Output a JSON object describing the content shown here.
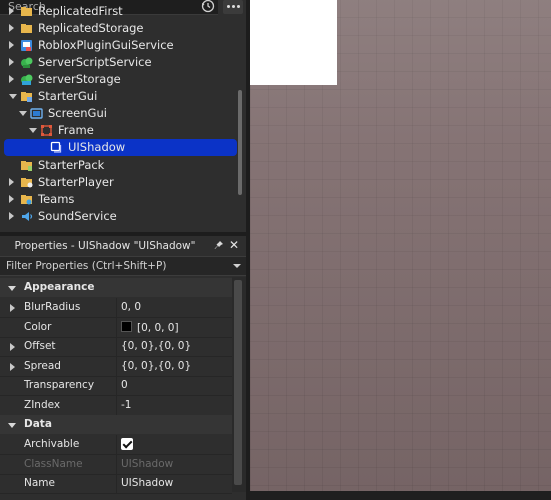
{
  "search": {
    "placeholder": "Search"
  },
  "explorer": {
    "items": [
      {
        "label": "ReplicatedFirst",
        "icon": "replicated-first-icon",
        "indent": 0,
        "arrow": "right"
      },
      {
        "label": "ReplicatedStorage",
        "icon": "folder-icon",
        "indent": 0,
        "arrow": "right"
      },
      {
        "label": "RobloxPluginGuiService",
        "icon": "plugin-gui-service-icon",
        "indent": 0,
        "arrow": "right"
      },
      {
        "label": "ServerScriptService",
        "icon": "server-script-service-icon",
        "indent": 0,
        "arrow": "right"
      },
      {
        "label": "ServerStorage",
        "icon": "server-storage-icon",
        "indent": 0,
        "arrow": "right"
      },
      {
        "label": "StarterGui",
        "icon": "starter-gui-icon",
        "indent": 0,
        "arrow": "down"
      },
      {
        "label": "ScreenGui",
        "icon": "screen-gui-icon",
        "indent": 1,
        "arrow": "down"
      },
      {
        "label": "Frame",
        "icon": "frame-icon",
        "indent": 2,
        "arrow": "down"
      },
      {
        "label": "UIShadow",
        "icon": "ui-shadow-icon",
        "indent": 3,
        "arrow": "none",
        "selected": true
      },
      {
        "label": "StarterPack",
        "icon": "starter-pack-icon",
        "indent": 0,
        "arrow": "none"
      },
      {
        "label": "StarterPlayer",
        "icon": "starter-player-icon",
        "indent": 0,
        "arrow": "right"
      },
      {
        "label": "Teams",
        "icon": "teams-icon",
        "indent": 0,
        "arrow": "right"
      },
      {
        "label": "SoundService",
        "icon": "sound-service-icon",
        "indent": 0,
        "arrow": "right"
      }
    ]
  },
  "properties": {
    "title": "Properties - UIShadow \"UIShadow\"",
    "filter_placeholder": "Filter Properties (Ctrl+Shift+P)",
    "sections": [
      {
        "name": "Appearance",
        "rows": [
          {
            "name": "BlurRadius",
            "value": "0, 0",
            "expandable": true
          },
          {
            "name": "Color",
            "value": "[0, 0, 0]",
            "swatch": "#000000"
          },
          {
            "name": "Offset",
            "value": "{0, 0},{0, 0}",
            "expandable": true
          },
          {
            "name": "Spread",
            "value": "{0, 0},{0, 0}",
            "expandable": true
          },
          {
            "name": "Transparency",
            "value": "0"
          },
          {
            "name": "ZIndex",
            "value": "-1"
          }
        ]
      },
      {
        "name": "Data",
        "rows": [
          {
            "name": "Archivable",
            "value": "",
            "checkbox": true,
            "checked": true
          },
          {
            "name": "ClassName",
            "value": "UIShadow",
            "dim": true
          },
          {
            "name": "Name",
            "value": "UIShadow"
          }
        ]
      }
    ]
  },
  "colors": {
    "selection": "#0b33c7",
    "panel_bg": "#2e2e2e",
    "viewport_floor": "#7d6a6b"
  }
}
